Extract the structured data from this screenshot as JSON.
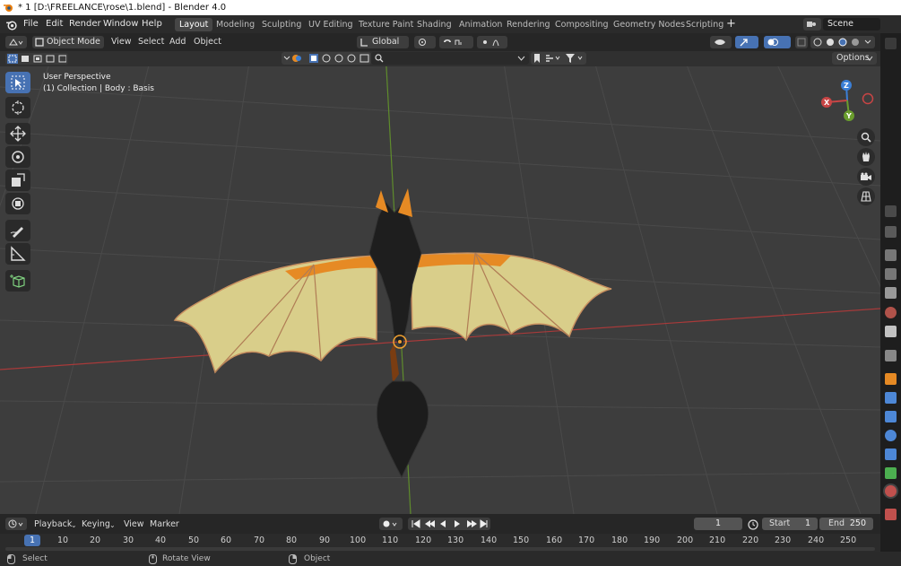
{
  "window": {
    "title": "* 1 [D:\\FREELANCE\\rose\\1.blend] - Blender 4.0"
  },
  "menu": {
    "file": "File",
    "edit": "Edit",
    "render": "Render",
    "window": "Window",
    "help": "Help"
  },
  "workspaces": [
    "Layout",
    "Modeling",
    "Sculpting",
    "UV Editing",
    "Texture Paint",
    "Shading",
    "Animation",
    "Rendering",
    "Compositing",
    "Geometry Nodes",
    "Scripting"
  ],
  "active_workspace": "Layout",
  "scene": {
    "label": "Scene"
  },
  "viewport_header": {
    "mode": "Object Mode",
    "view": "View",
    "select": "Select",
    "add": "Add",
    "object": "Object",
    "orientation": "Global",
    "options": "Options"
  },
  "viewport": {
    "perspective": "User Perspective",
    "collection_info": "(1) Collection | Body : Basis"
  },
  "gizmo": {
    "z": "Z",
    "x": "X",
    "y": "Y"
  },
  "timeline": {
    "playback": "Playback",
    "keying": "Keying",
    "view": "View",
    "marker": "Marker",
    "current_frame": "1",
    "start_label": "Start",
    "start": "1",
    "end_label": "End",
    "end": "250",
    "ruler": [
      "1",
      "10",
      "20",
      "30",
      "40",
      "50",
      "60",
      "70",
      "80",
      "90",
      "100",
      "110",
      "120",
      "130",
      "140",
      "150",
      "160",
      "170",
      "180",
      "190",
      "200",
      "210",
      "220",
      "230",
      "240",
      "250"
    ]
  },
  "status": {
    "select": "Select",
    "rotate": "Rotate View",
    "object": "Object"
  },
  "colors": {
    "accent": "#4772b3",
    "x_axis": "#c84545",
    "y_axis": "#6a9d2d",
    "z_axis": "#3b7fd6",
    "wing": "#d6cb85",
    "orange": "#e68a24"
  }
}
